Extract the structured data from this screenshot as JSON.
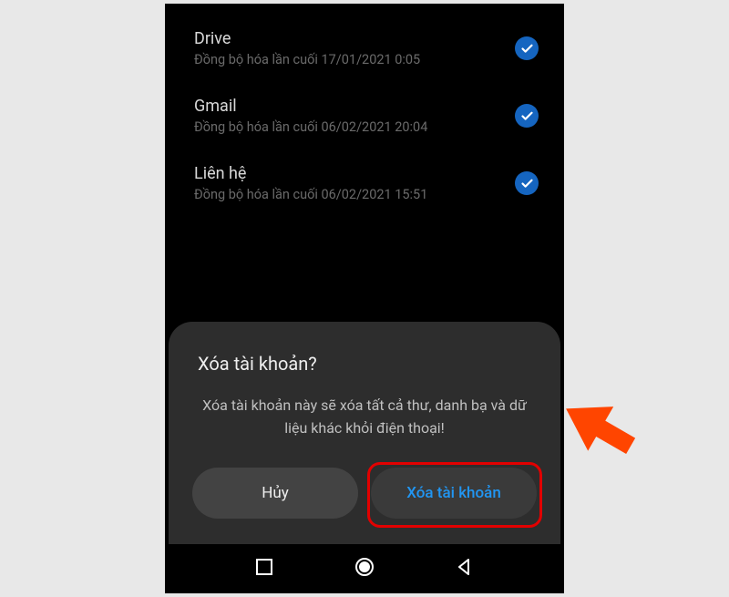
{
  "sync_items": [
    {
      "title": "Drive",
      "subtitle": "Đồng bộ hóa lần cuối 17/01/2021 0:05"
    },
    {
      "title": "Gmail",
      "subtitle": "Đồng bộ hóa lần cuối 06/02/2021 20:04"
    },
    {
      "title": "Liên hệ",
      "subtitle": "Đồng bộ hóa lần cuối 06/02/2021 15:51"
    }
  ],
  "dialog": {
    "title": "Xóa tài khoản?",
    "message": "Xóa tài khoản này sẽ xóa tất cả thư, danh bạ và dữ liệu khác khỏi điện thoại!",
    "cancel_label": "Hủy",
    "confirm_label": "Xóa tài khoản"
  },
  "colors": {
    "accent": "#2196f3",
    "check_bg": "#1565c0",
    "highlight": "#e20000",
    "arrow": "#ff4500"
  }
}
